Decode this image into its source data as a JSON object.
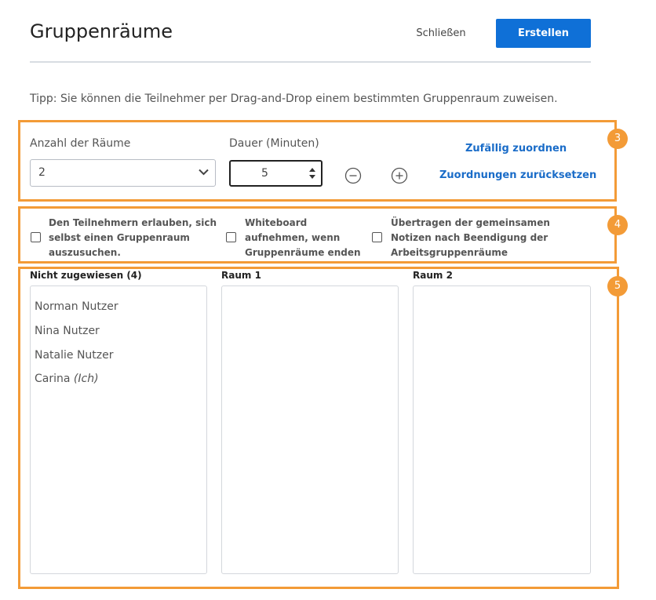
{
  "header": {
    "title": "Gruppenräume",
    "close_label": "Schließen",
    "create_label": "Erstellen"
  },
  "tip": "Tipp: Sie können die Teilnehmer per Drag-and-Drop einem bestimmten Gruppenraum zuweisen.",
  "settings": {
    "rooms_label": "Anzahl der Räume",
    "rooms_value": "2",
    "duration_label": "Dauer (Minuten)",
    "duration_value": "5",
    "random_label": "Zufällig zuordnen",
    "reset_label": "Zuordnungen zurücksetzen"
  },
  "options": {
    "allow_choose": [
      "Den Teilnehmern erlauben, sich",
      "selbst einen Gruppenraum",
      "auszusuchen."
    ],
    "record_whiteboard": [
      "Whiteboard",
      "aufnehmen, wenn",
      "Gruppenräume enden"
    ],
    "transfer_notes": [
      "Übertragen der gemeinsamen",
      "Notizen nach Beendigung der",
      "Arbeitsgruppenräume"
    ]
  },
  "annotations": {
    "badge_3": "3",
    "badge_4": "4",
    "badge_5": "5"
  },
  "columns": {
    "unassigned": {
      "title": "Nicht zugewiesen (4)",
      "people": [
        {
          "name": "Norman Nutzer",
          "suffix": ""
        },
        {
          "name": "Nina Nutzer",
          "suffix": ""
        },
        {
          "name": "Natalie Nutzer",
          "suffix": ""
        },
        {
          "name": "Carina",
          "suffix": "(Ich)"
        }
      ]
    },
    "room1": {
      "title": "Raum 1"
    },
    "room2": {
      "title": "Raum 2"
    }
  },
  "colors": {
    "accent_orange": "#f39b37",
    "primary_blue": "#0f70d7",
    "link_blue": "#1a6cc8"
  }
}
